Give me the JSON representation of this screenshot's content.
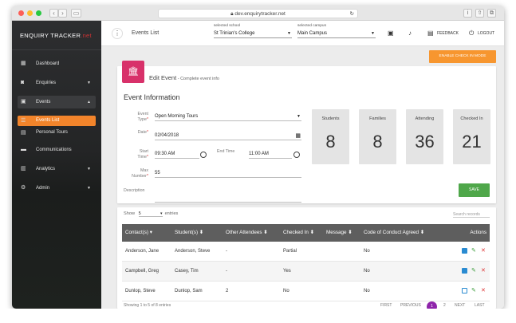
{
  "browser": {
    "url": "dev.enquirytracker.net"
  },
  "sidebar": {
    "brand": "ENQUIRY TRACKER",
    "brand_tld": ".net",
    "items": [
      {
        "label": "Dashboard",
        "icon": "dashboard-icon"
      },
      {
        "label": "Enquiries",
        "icon": "person-icon"
      },
      {
        "label": "Events",
        "icon": "calendar-icon"
      },
      {
        "label": "Events List",
        "icon": "list-icon"
      },
      {
        "label": "Personal Tours",
        "icon": "tour-icon"
      },
      {
        "label": "Communications",
        "icon": "chat-icon"
      },
      {
        "label": "Analytics",
        "icon": "chart-icon"
      },
      {
        "label": "Admin",
        "icon": "settings-icon"
      }
    ]
  },
  "appbar": {
    "title": "Events List",
    "school_label": "selected school",
    "school_value": "St Trinian's College",
    "campus_label": "selected campus",
    "campus_value": "Main Campus",
    "feedback": "FEEDBACK",
    "logout": "LOGOUT"
  },
  "enable_checkin": "ENABLE CHECK IN MODE",
  "edit": {
    "title": "Edit Event",
    "subtitle": " - Complete event info"
  },
  "section_title": "Event Information",
  "form": {
    "event_type_label": "Event Type",
    "event_type_value": "Open Morning Tours",
    "date_label": "Date",
    "date_value": "02/04/2018",
    "start_label": "Start Time",
    "start_value": "09:30 AM",
    "end_label": "End Time",
    "end_value": "11:00 AM",
    "max_label": "Max Number",
    "max_value": "55",
    "desc_label": "Description"
  },
  "stats": [
    {
      "title": "Students",
      "value": "8"
    },
    {
      "title": "Families",
      "value": "8"
    },
    {
      "title": "Attending",
      "value": "36"
    },
    {
      "title": "Checked In",
      "value": "21"
    }
  ],
  "save_label": "SAVE",
  "table": {
    "show_label": "Show",
    "show_value": "5",
    "entries_label": "entries",
    "search_placeholder": "Search records",
    "headers": [
      "Contact(s)",
      "Student(s)",
      "Other Attendees",
      "Checked In",
      "Message",
      "Code of Conduct Agreed",
      "Actions"
    ],
    "rows": [
      {
        "contact": "Anderson, Jane",
        "student": "Anderson, Steve",
        "other": "-",
        "checked": "Partial",
        "message": "",
        "conduct": "No"
      },
      {
        "contact": "Campbell, Greg",
        "student": "Casey, Tim",
        "other": "-",
        "checked": "Yes",
        "message": "",
        "conduct": "No"
      },
      {
        "contact": "Dunlop, Steve",
        "student": "Dunlop, Sam",
        "other": "2",
        "checked": "No",
        "message": "",
        "conduct": "No"
      }
    ]
  },
  "footer": {
    "info": "Showing 1 to 5 of 8 entries",
    "first": "FIRST",
    "previous": "PREVIOUS",
    "page1": "1",
    "page2": "2",
    "next": "NEXT",
    "last": "LAST"
  },
  "colors": {
    "accent": "#f7962f",
    "badge": "#d8316a",
    "save": "#4fa74a",
    "table_header": "#5e5e5e"
  }
}
